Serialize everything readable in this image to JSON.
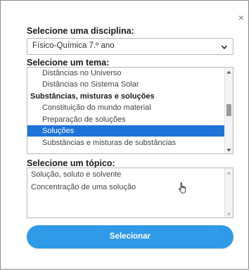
{
  "dialog": {
    "close_label": "×",
    "discipline_heading": "Selecione uma disciplina:",
    "discipline_selected": "Físico-Química 7.º ano",
    "theme_heading": "Selecione um tema:",
    "theme_items": [
      {
        "label": "Distâncias no Universo",
        "kind": "option",
        "selected": false
      },
      {
        "label": "Distâncias no Sistema Solar",
        "kind": "option",
        "selected": false
      },
      {
        "label": "Substâncias, misturas e soluções",
        "kind": "group",
        "selected": false
      },
      {
        "label": "Constituição do mundo material",
        "kind": "option",
        "selected": false
      },
      {
        "label": "Preparação de soluções",
        "kind": "option",
        "selected": false
      },
      {
        "label": "Soluções",
        "kind": "option",
        "selected": true
      },
      {
        "label": "Substâncias e misturas de substâncias",
        "kind": "option",
        "selected": false
      }
    ],
    "topic_heading": "Selecione um tópico:",
    "topic_items": [
      "Solução, soluto e solvente",
      "Concentração de uma solução"
    ],
    "submit_label": "Selecionar"
  },
  "colors": {
    "accent": "#2f9ae8",
    "selection": "#1e73d8"
  }
}
